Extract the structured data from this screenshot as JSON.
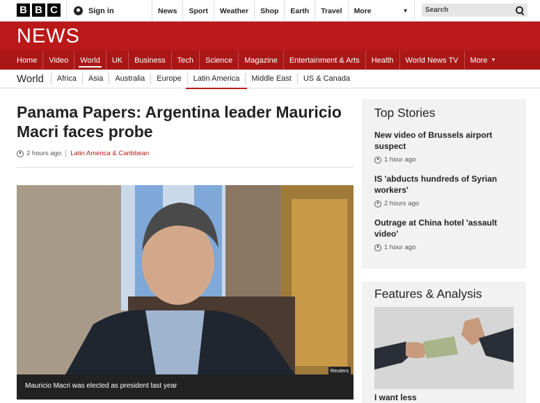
{
  "topbar": {
    "logo_letters": [
      "B",
      "B",
      "C"
    ],
    "signin_label": "Sign in",
    "nav": [
      "News",
      "Sport",
      "Weather",
      "Shop",
      "Earth",
      "Travel"
    ],
    "more_label": "More",
    "search_placeholder": "Search"
  },
  "brand": {
    "news": "NEWS"
  },
  "section_nav": {
    "items": [
      "Home",
      "Video",
      "World",
      "UK",
      "Business",
      "Tech",
      "Science",
      "Magazine",
      "Entertainment & Arts",
      "Health",
      "World News TV",
      "More"
    ],
    "active": "World"
  },
  "sub_nav": {
    "title": "World",
    "items": [
      "Africa",
      "Asia",
      "Australia",
      "Europe",
      "Latin America",
      "Middle East",
      "US & Canada"
    ],
    "active": "Latin America"
  },
  "article": {
    "headline": "Panama Papers: Argentina leader Mauricio Macri faces probe",
    "time": "2 hours ago",
    "section": "Latin America & Caribbean",
    "image_credit": "Reuters",
    "caption": "Mauricio Macri was elected as president last year"
  },
  "top_stories": {
    "title": "Top Stories",
    "items": [
      {
        "title": "New video of Brussels airport suspect",
        "time": "1 hour ago"
      },
      {
        "title": "IS 'abducts hundreds of Syrian workers'",
        "time": "2 hours ago"
      },
      {
        "title": "Outrage at China hotel 'assault video'",
        "time": "1 hour ago"
      }
    ]
  },
  "features": {
    "title": "Features & Analysis",
    "item_title": "I want less"
  },
  "colors": {
    "brand_red": "#bb1919",
    "nav_red": "#a91717"
  }
}
